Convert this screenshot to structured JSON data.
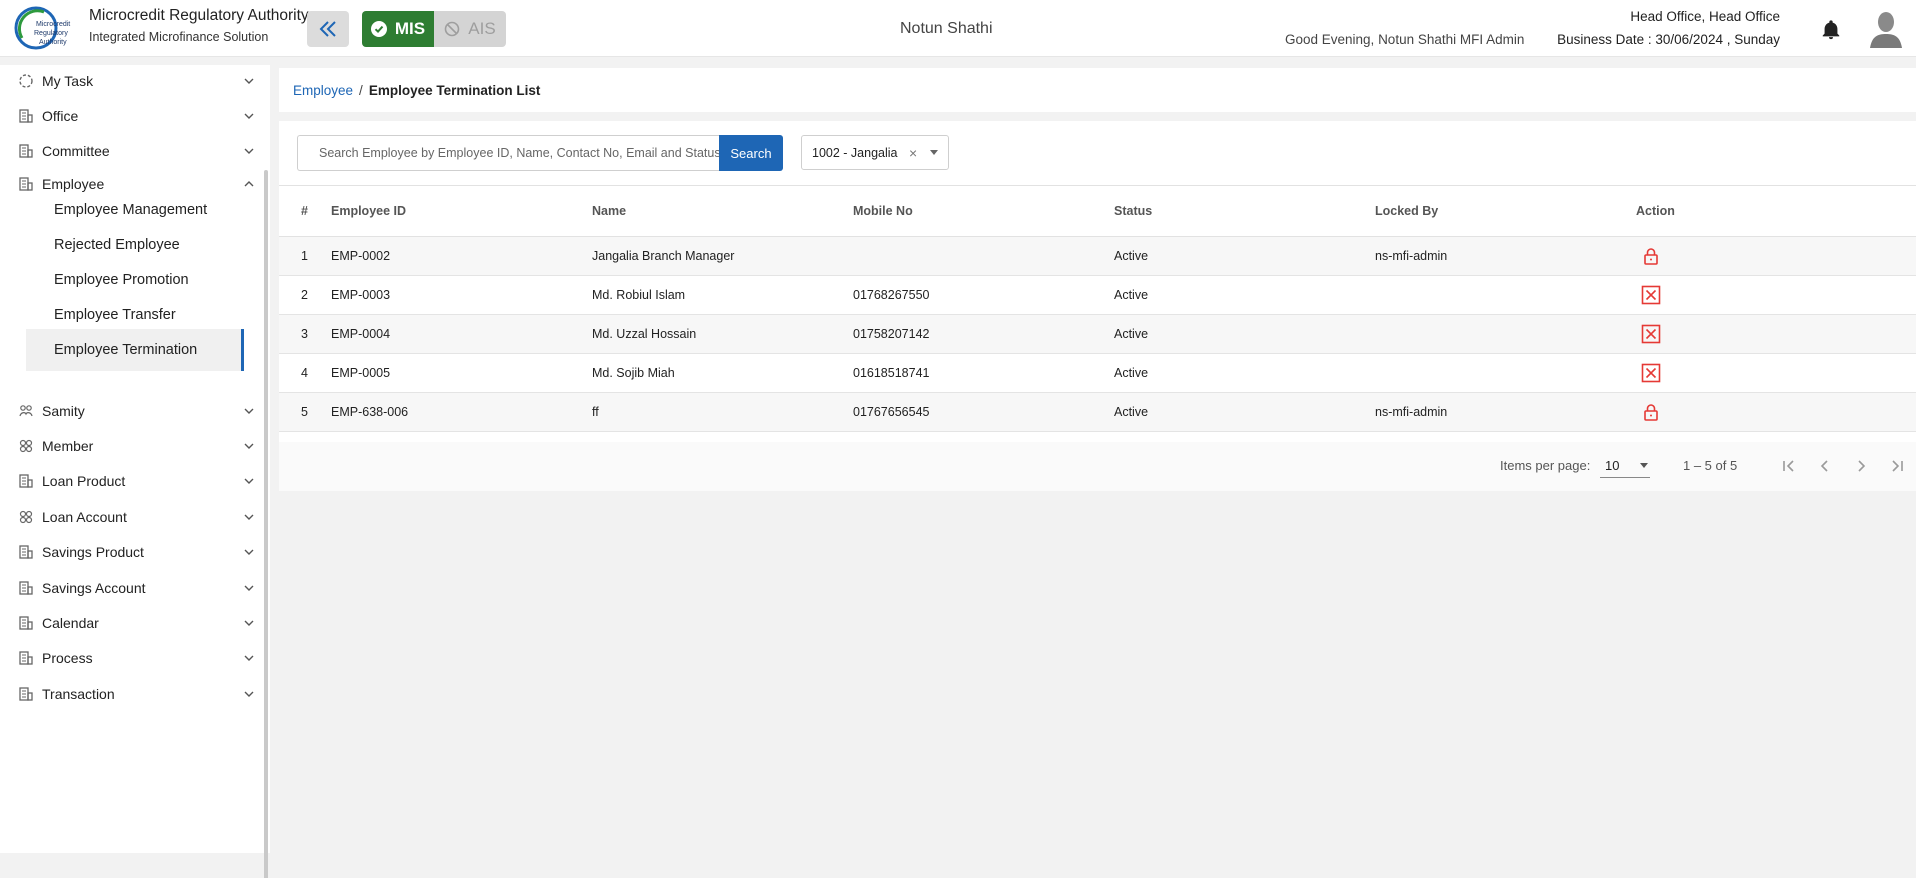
{
  "header": {
    "org_title": "Microcredit Regulatory Authority",
    "org_subtitle": "Integrated Microfinance Solution",
    "logo_text": [
      "Microcredit",
      "Regulatory",
      "Authority"
    ],
    "modes": {
      "mis": "MIS",
      "ais": "AIS"
    },
    "center_name": "Notun Shathi",
    "greeting": "Good Evening, Notun Shathi MFI Admin",
    "office": "Head Office, Head Office",
    "business_date": "Business Date : 30/06/2024 , Sunday"
  },
  "sidebar": {
    "items": [
      {
        "label": "My Task",
        "icon": "task-icon"
      },
      {
        "label": "Office",
        "icon": "office-icon"
      },
      {
        "label": "Committee",
        "icon": "committee-icon"
      },
      {
        "label": "Employee",
        "icon": "employee-icon",
        "expanded": true
      },
      {
        "label": "Samity",
        "icon": "samity-icon"
      },
      {
        "label": "Member",
        "icon": "member-icon"
      },
      {
        "label": "Loan Product",
        "icon": "loan-product-icon"
      },
      {
        "label": "Loan Account",
        "icon": "loan-account-icon"
      },
      {
        "label": "Savings Product",
        "icon": "savings-product-icon"
      },
      {
        "label": "Savings Account",
        "icon": "savings-account-icon"
      },
      {
        "label": "Calendar",
        "icon": "calendar-icon"
      },
      {
        "label": "Process",
        "icon": "process-icon"
      },
      {
        "label": "Transaction",
        "icon": "transaction-icon"
      }
    ],
    "employee_sub": [
      {
        "label": "Employee Management"
      },
      {
        "label": "Rejected Employee"
      },
      {
        "label": "Employee Promotion"
      },
      {
        "label": "Employee Transfer"
      },
      {
        "label": "Employee Termination",
        "active": true
      }
    ]
  },
  "breadcrumb": {
    "parent": "Employee",
    "separator": "/",
    "current": "Employee Termination List"
  },
  "search": {
    "placeholder": "Search Employee by Employee ID, Name, Contact No, Email and Status",
    "button": "Search"
  },
  "branch_filter": {
    "value": "1002 - Jangalia",
    "clear": "×"
  },
  "table": {
    "headers": [
      "#",
      "Employee ID",
      "Name",
      "Mobile No",
      "Status",
      "Locked By",
      "Action"
    ],
    "rows": [
      {
        "n": "1",
        "id": "EMP-0002",
        "name": "Jangalia Branch Manager",
        "mobile": "",
        "status": "Active",
        "locked_by": "ns-mfi-admin",
        "action_icon": "lock-icon"
      },
      {
        "n": "2",
        "id": "EMP-0003",
        "name": "Md. Robiul Islam",
        "mobile": "01768267550",
        "status": "Active",
        "locked_by": "",
        "action_icon": "terminate-icon"
      },
      {
        "n": "3",
        "id": "EMP-0004",
        "name": "Md. Uzzal Hossain",
        "mobile": "01758207142",
        "status": "Active",
        "locked_by": "",
        "action_icon": "terminate-icon"
      },
      {
        "n": "4",
        "id": "EMP-0005",
        "name": "Md. Sojib Miah",
        "mobile": "01618518741",
        "status": "Active",
        "locked_by": "",
        "action_icon": "terminate-icon"
      },
      {
        "n": "5",
        "id": "EMP-638-006",
        "name": "ff",
        "mobile": "01767656545",
        "status": "Active",
        "locked_by": "ns-mfi-admin",
        "action_icon": "lock-icon"
      }
    ]
  },
  "paginator": {
    "label": "Items per page:",
    "page_size": "10",
    "range": "1 – 5 of 5"
  },
  "colors": {
    "primary": "#1e66b5",
    "mis_green": "#2e7d32",
    "status_green": "#2e8b2e",
    "action_red": "#e53935"
  }
}
